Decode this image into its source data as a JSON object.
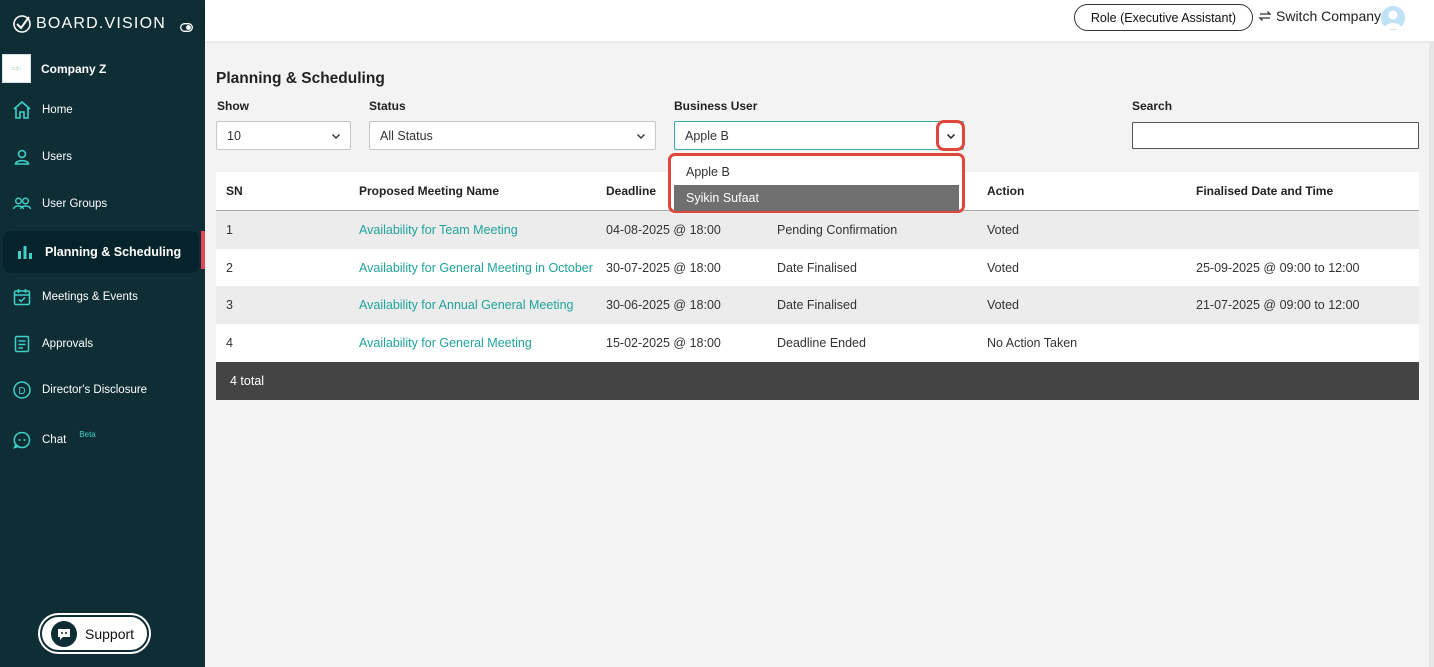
{
  "brand": {
    "name": "BOARD.VISION"
  },
  "company": {
    "name": "Company Z"
  },
  "sidebar": {
    "items": [
      {
        "label": "Home",
        "icon": "home-icon"
      },
      {
        "label": "Users",
        "icon": "user-icon"
      },
      {
        "label": "User Groups",
        "icon": "user-group-icon"
      },
      {
        "label": "Planning & Scheduling",
        "icon": "bar-chart-icon",
        "active": true
      },
      {
        "label": "Meetings & Events",
        "icon": "calendar-icon"
      },
      {
        "label": "Approvals",
        "icon": "document-icon"
      },
      {
        "label": "Director's Disclosure",
        "icon": "circle-d-icon"
      },
      {
        "label": "Chat",
        "icon": "chat-icon",
        "badge": "Beta"
      }
    ],
    "support_label": "Support"
  },
  "header": {
    "role_label": "Role (Executive Assistant)",
    "switch_label": "Switch Company"
  },
  "page": {
    "title": "Planning & Scheduling",
    "filters": {
      "show_label": "Show",
      "show_value": "10",
      "status_label": "Status",
      "status_value": "All Status",
      "business_user_label": "Business User",
      "business_user_value": "Apple B",
      "search_label": "Search",
      "search_value": ""
    },
    "dropdown_options": [
      {
        "label": "Apple B",
        "selected": false
      },
      {
        "label": "Syikin Sufaat",
        "selected": true
      }
    ]
  },
  "table": {
    "headers": [
      "SN",
      "Proposed Meeting Name",
      "Deadline",
      "",
      "Action",
      "Finalised Date and Time"
    ],
    "rows": [
      [
        "1",
        "Availability for Team Meeting",
        "04-08-2025 @ 18:00",
        "Pending Confirmation",
        "Voted",
        ""
      ],
      [
        "2",
        "Availability for General Meeting in October",
        "30-07-2025 @ 18:00",
        "Date Finalised",
        "Voted",
        "25-09-2025 @ 09:00 to 12:00"
      ],
      [
        "3",
        "Availability for Annual General Meeting",
        "30-06-2025 @ 18:00",
        "Date Finalised",
        "Voted",
        "21-07-2025 @ 09:00 to 12:00"
      ],
      [
        "4",
        "Availability for General Meeting",
        "15-02-2025 @ 18:00",
        "Deadline Ended",
        "No Action Taken",
        ""
      ]
    ],
    "footer": "4 total"
  },
  "colors": {
    "sidebar": "#0e2d35",
    "accent": "#20a39a",
    "highlight": "#e0463a",
    "active_marker": "#e2485a"
  }
}
